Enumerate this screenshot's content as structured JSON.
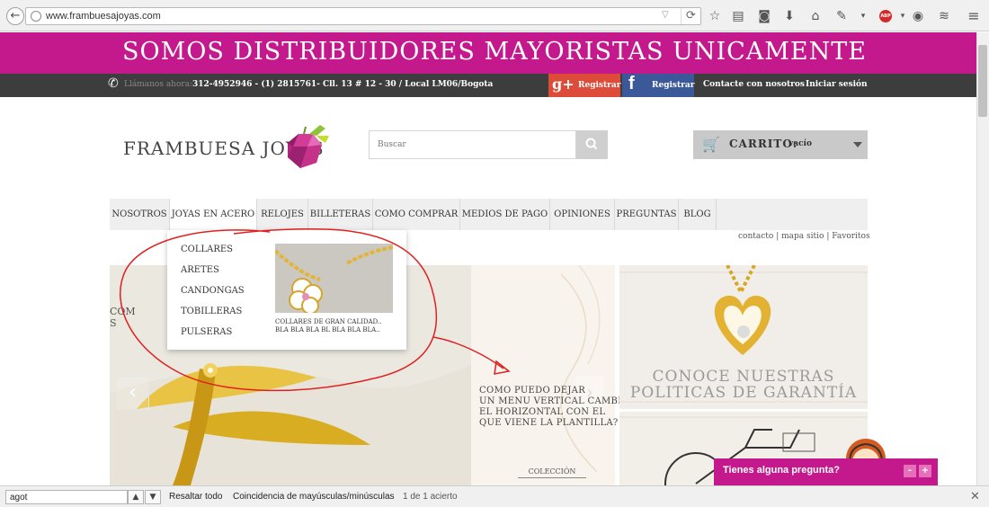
{
  "browser": {
    "url": "www.frambuesajoyas.com",
    "icons": [
      "back-icon",
      "globe-icon",
      "reload-icon",
      "bookmark-star-icon",
      "reading-list-icon",
      "pocket-icon",
      "download-icon",
      "home-icon",
      "extension-icon",
      "adblock-icon",
      "chat-icon",
      "layers-icon",
      "menu-icon"
    ],
    "adblock_label": "ABP"
  },
  "banner": {
    "text": "SOMOS DISTRIBUIDORES MAYORISTAS UNICAMENTE",
    "color": "#c4188d"
  },
  "infobar": {
    "call_label": "Llámanos ahora:",
    "call_info": "312-4952946 - (1) 2815761- Cll. 13 # 12 - 30 / Local LM06/Bogota",
    "gplus_icon": "g+",
    "gplus_label": "Registrar",
    "fb_icon": "f",
    "fb_label": "Registrar",
    "contact_label": "Contacte con nosotros",
    "login_label": "Iniciar sesión"
  },
  "logo": {
    "text": "FRAMBUESA JOYAS"
  },
  "search": {
    "placeholder": "Buscar"
  },
  "cart": {
    "label": "CARRITO:",
    "status": "vacío"
  },
  "nav": {
    "items": [
      {
        "label": "NOSOTROS"
      },
      {
        "label": "JOYAS EN ACERO"
      },
      {
        "label": "RELOJES"
      },
      {
        "label": "BILLETERAS"
      },
      {
        "label": "COMO COMPRAR"
      },
      {
        "label": "MEDIOS DE PAGO"
      },
      {
        "label": "OPINIONES"
      },
      {
        "label": "PREGUNTAS"
      },
      {
        "label": "BLOG"
      }
    ]
  },
  "quicklinks": {
    "contact": "contacto",
    "sitemap": "mapa sitio",
    "favorites": "Favoritos",
    "separator": "|"
  },
  "dropdown": {
    "items": [
      {
        "label": "COLLARES"
      },
      {
        "label": "ARETES"
      },
      {
        "label": "CANDONGAS"
      },
      {
        "label": "TOBILLERAS"
      },
      {
        "label": "PULSERAS"
      }
    ],
    "caption_title": "COLLARES DE GRAN CALIDAD..",
    "caption_body": "BLA BLA BLA BL BLA BLA BLA.."
  },
  "slider": {
    "text": "COM",
    "text2": "S",
    "prev": "‹",
    "next": "›"
  },
  "tiles": {
    "note_lines": [
      "COMO PUEDO DEJAR",
      "UN MENU VERTICAL CAMBIANDO",
      "EL HORIZONTAL CON EL",
      "QUE VIENE LA PLANTILLA?"
    ],
    "coleccion": "COLECCIÓN",
    "guarantee_line1": "CONOCE NUESTRAS",
    "guarantee_line2": "POLITICAS DE GARANTÍA"
  },
  "chat": {
    "label": "Tienes alguna pregunta?",
    "minimize": "-",
    "expand": "+"
  },
  "findbar": {
    "value": "agot",
    "prev": "▲",
    "next": "▼",
    "highlight_all": "Resaltar todo",
    "match_case": "Coincidencia de mayúsculas/minúsculas",
    "result": "1 de 1 acierto",
    "close": "✕"
  },
  "colors": {
    "brand": "#c4188d",
    "infobar": "#3d3d3d",
    "gplus": "#dd4b39",
    "facebook": "#3b5998",
    "annotation": "#e02020"
  }
}
